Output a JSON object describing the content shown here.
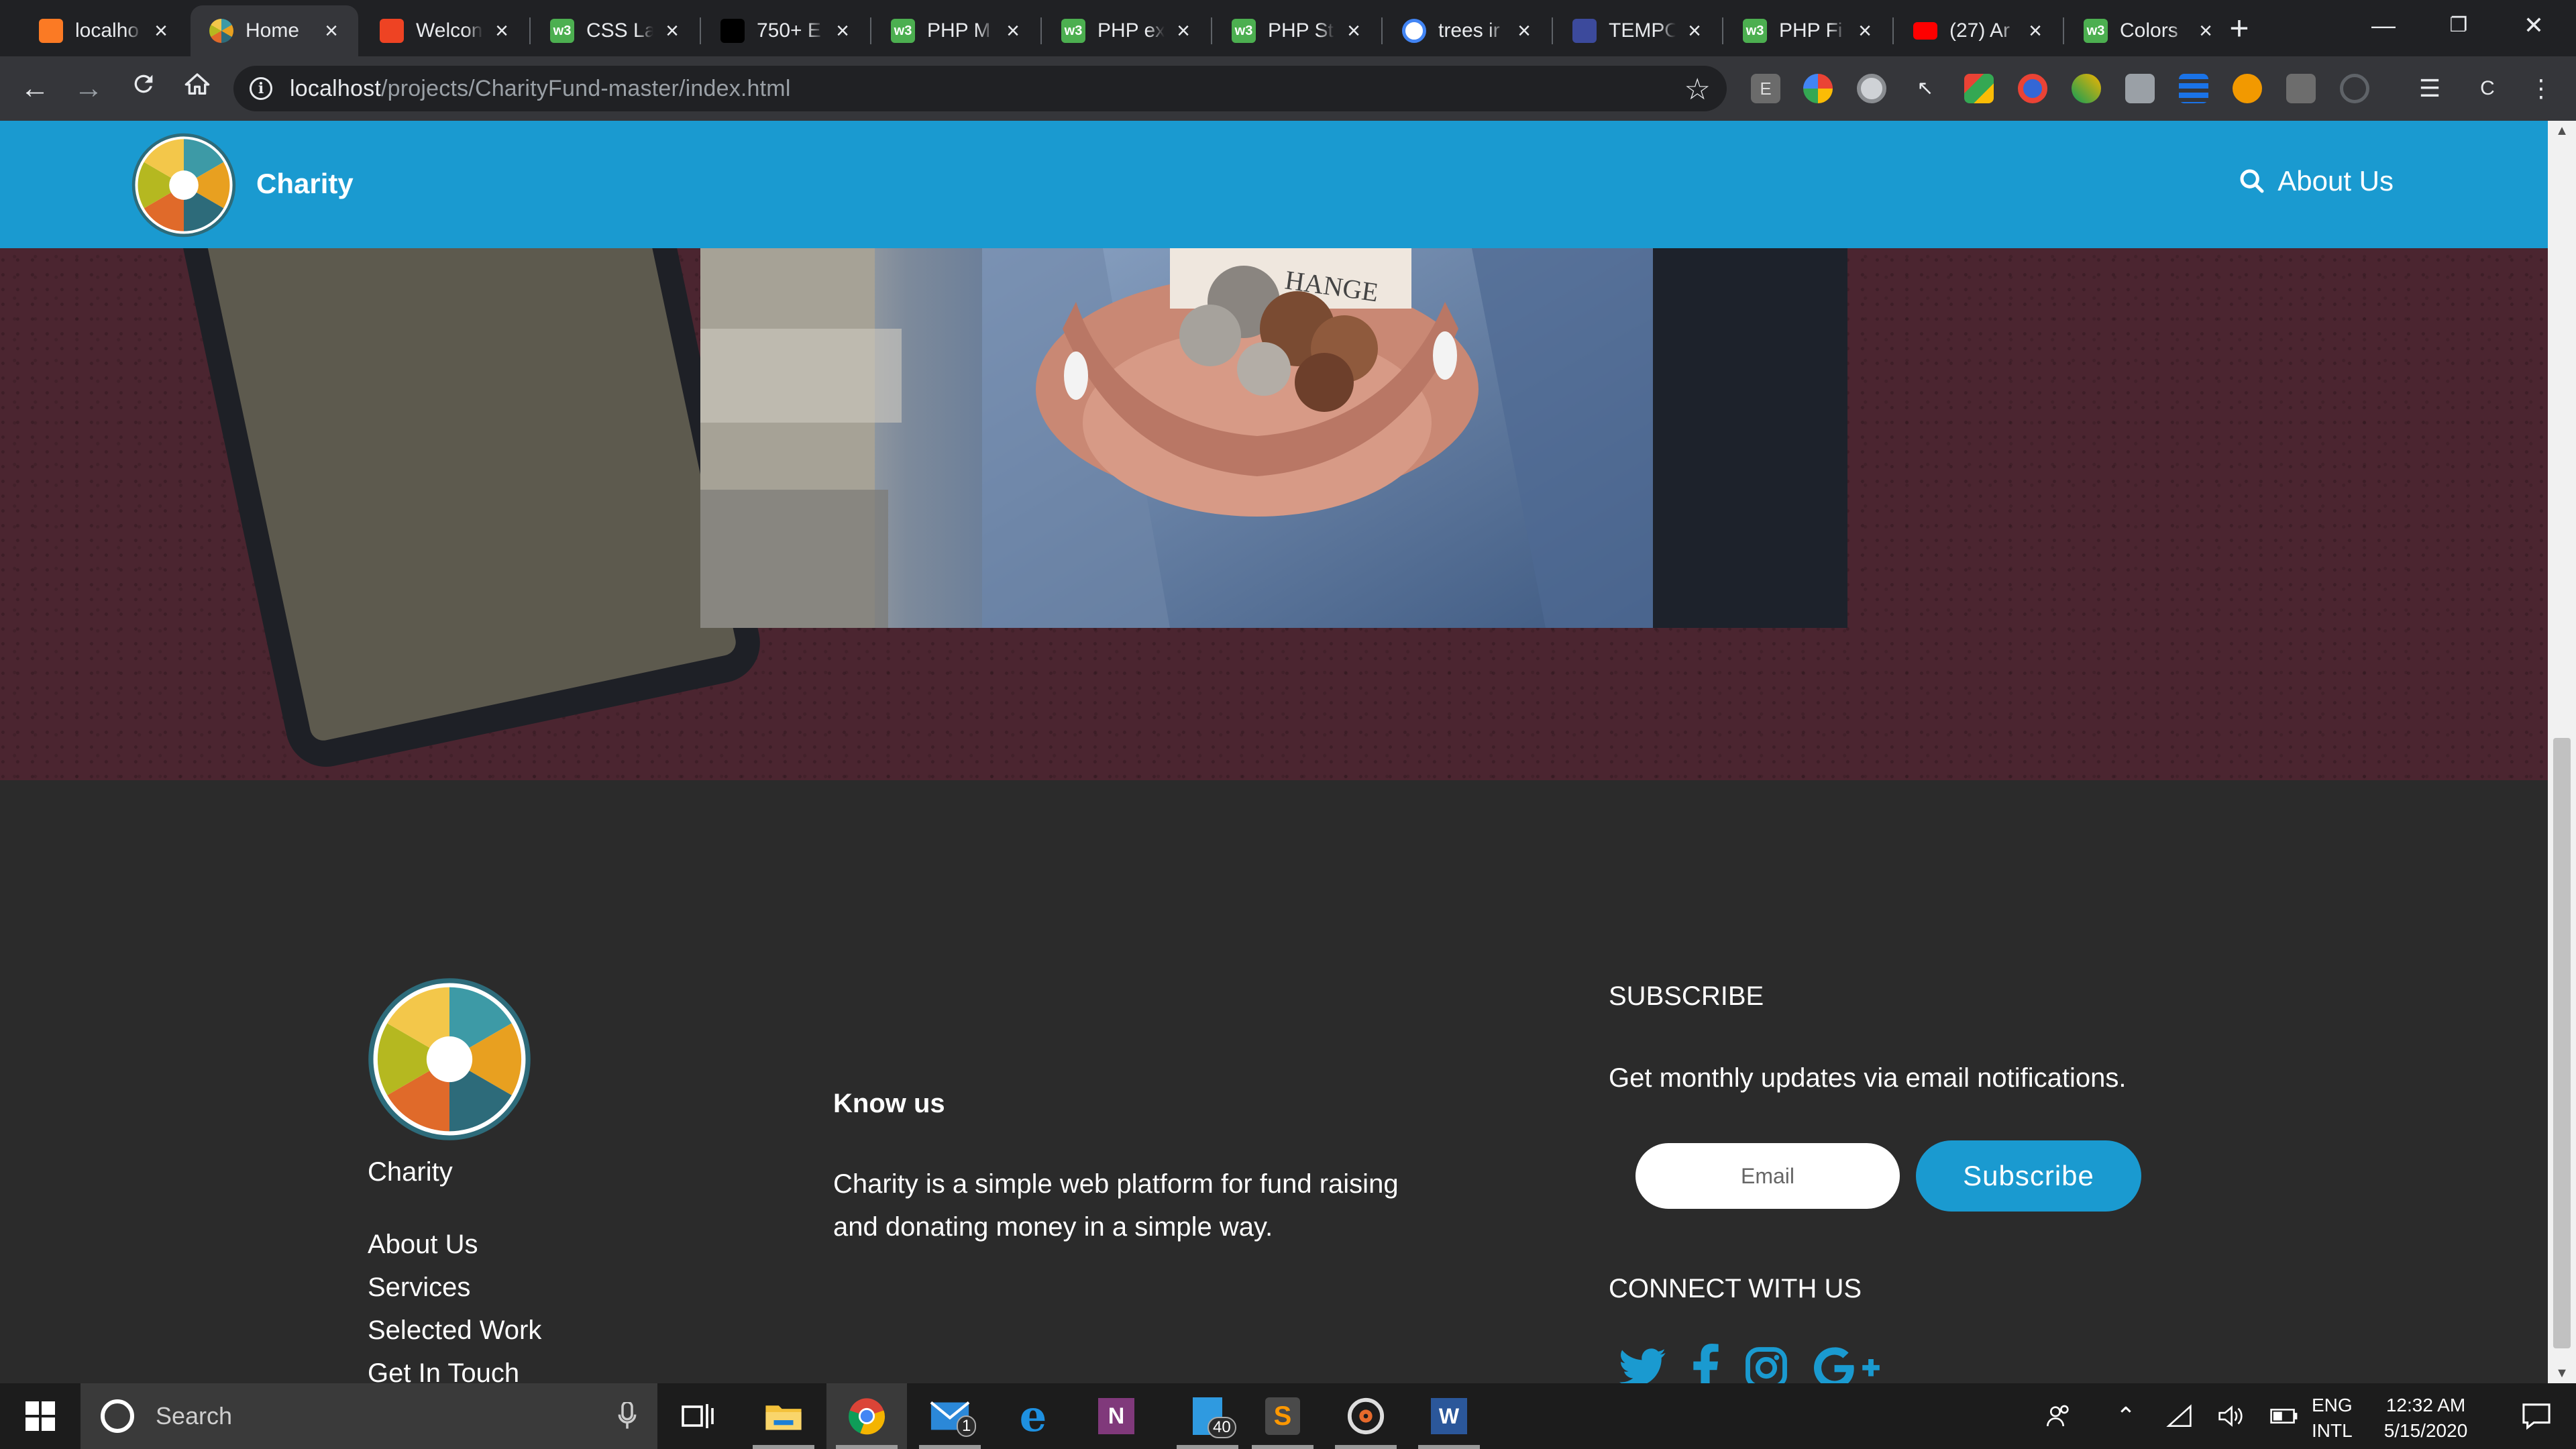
{
  "browser": {
    "tabs": [
      {
        "label": "localho",
        "favicon": "xampp-icon",
        "color": "#fb7a24",
        "active": false
      },
      {
        "label": "Home",
        "favicon": "charity-icon",
        "color": "#f4b400",
        "active": true
      },
      {
        "label": "Welcon",
        "favicon": "codeigniter-icon",
        "color": "#ee4323",
        "active": false
      },
      {
        "label": "CSS La",
        "favicon": "w3schools-icon",
        "color": "#4caf50",
        "active": false
      },
      {
        "label": "750+ E",
        "favicon": "dark-site-icon",
        "color": "#000000",
        "active": false
      },
      {
        "label": "PHP M",
        "favicon": "w3schools-icon",
        "color": "#4caf50",
        "active": false
      },
      {
        "label": "PHP ex",
        "favicon": "w3schools-icon",
        "color": "#4caf50",
        "active": false
      },
      {
        "label": "PHP St",
        "favicon": "w3schools-icon",
        "color": "#4caf50",
        "active": false
      },
      {
        "label": "trees ir",
        "favicon": "google-icon",
        "color": "#ffffff",
        "active": false
      },
      {
        "label": "TEMPO",
        "favicon": "tempo-icon",
        "color": "#3c4a9c",
        "active": false
      },
      {
        "label": "PHP Fi",
        "favicon": "w3schools-icon",
        "color": "#4caf50",
        "active": false
      },
      {
        "label": "(27) Ar",
        "favicon": "youtube-icon",
        "color": "#ff0000",
        "active": false
      },
      {
        "label": "Colors",
        "favicon": "w3schools-icon",
        "color": "#4caf50",
        "active": false
      }
    ],
    "w3_abbrev": "w3",
    "url_host": "localhost",
    "url_path": "/projects/CharityFund-master/index.html",
    "profile_initial": "C"
  },
  "site": {
    "brand": "Charity",
    "nav_about": "About Us",
    "accent": "#1a9ad0",
    "hero_bg": "#4b2530"
  },
  "footer": {
    "brand": "Charity",
    "links": [
      "About Us",
      "Services",
      "Selected Work",
      "Get In Touch"
    ],
    "know_title": "Know us",
    "know_text": "Charity is a simple web platform for fund raising and donating money in a simple way.",
    "subscribe_title": "SUBSCRIBE",
    "subscribe_text": "Get monthly updates via email notifications.",
    "email_placeholder": "Email",
    "subscribe_button": "Subscribe",
    "connect_title": "CONNECT WITH US",
    "socials": [
      "twitter-icon",
      "facebook-icon",
      "instagram-icon",
      "google-plus-icon"
    ],
    "social_color": "#1a9ad0"
  },
  "taskbar": {
    "search_placeholder": "Search",
    "mail_badge": "1",
    "files_badge": "40",
    "lang_line1": "ENG",
    "lang_line2": "INTL",
    "time": "12:32 AM",
    "date": "5/15/2020"
  }
}
